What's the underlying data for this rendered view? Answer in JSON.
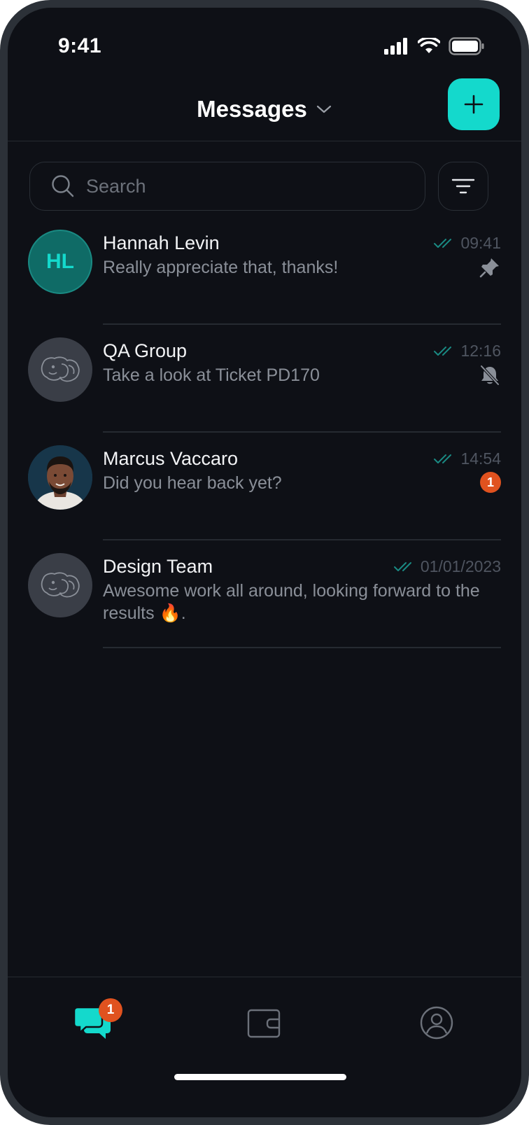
{
  "status_bar": {
    "time": "9:41"
  },
  "header": {
    "title": "Messages"
  },
  "search": {
    "placeholder": "Search"
  },
  "conversations": [
    {
      "name": "Hannah Levin",
      "preview": "Really appreciate that, thanks!",
      "time": "09:41",
      "avatar_initials": "HL",
      "status_icon": "pin-icon"
    },
    {
      "name": "QA Group",
      "preview": "Take a look at Ticket PD170",
      "time": "12:16",
      "status_icon": "bell-off-icon"
    },
    {
      "name": "Marcus Vaccaro",
      "preview": "Did you hear back yet?",
      "time": "14:54",
      "unread": "1"
    },
    {
      "name": "Design Team",
      "preview": "Awesome work all around, looking forward to the results 🔥.",
      "time": "01/01/2023"
    }
  ],
  "tabbar": {
    "messages_badge": "1"
  },
  "colors": {
    "accent": "#14d9cc",
    "badge": "#e0521f",
    "background": "#0e1016"
  }
}
